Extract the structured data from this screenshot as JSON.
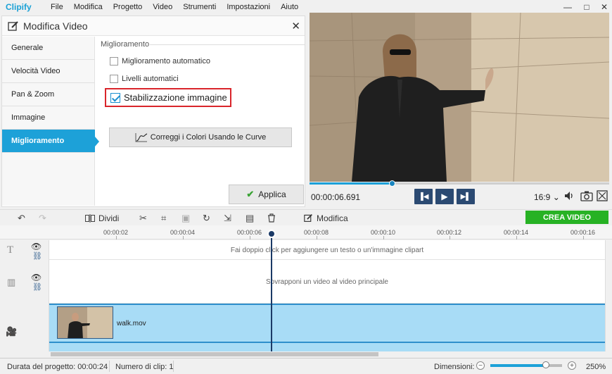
{
  "app": {
    "logo": "Clipify"
  },
  "menu": [
    "File",
    "Modifica",
    "Progetto",
    "Video",
    "Strumenti",
    "Impostazioni",
    "Aiuto"
  ],
  "window_controls": {
    "minimize": "—",
    "maximize": "□",
    "close": "✕"
  },
  "edit_panel": {
    "title": "Modifica Video",
    "nav": [
      {
        "label": "Generale",
        "active": false
      },
      {
        "label": "Velocità Video",
        "active": false
      },
      {
        "label": "Pan & Zoom",
        "active": false
      },
      {
        "label": "Immagine",
        "active": false
      },
      {
        "label": "Miglioramento",
        "active": true
      }
    ],
    "section_title": "Miglioramento",
    "options": {
      "auto_enhance": {
        "label": "Miglioramento automatico",
        "checked": false
      },
      "auto_levels": {
        "label": "Livelli automatici",
        "checked": false
      },
      "stabilization": {
        "label": "Stabilizzazione immagine",
        "checked": true
      }
    },
    "curves_button": "Correggi i Colori Usando le Curve",
    "apply_button": "Applica"
  },
  "player": {
    "time": "00:00:06.691",
    "progress": 0.275,
    "aspect_ratio": "16:9",
    "aspect_chevron": "⌄"
  },
  "toolbar": {
    "split_label": "Dividi",
    "edit_label": "Modifica",
    "create_label": "CREA VIDEO"
  },
  "ruler": [
    "00:00:02",
    "00:00:04",
    "00:00:06",
    "00:00:08",
    "00:00:10",
    "00:00:12",
    "00:00:14",
    "00:00:16"
  ],
  "tracks": {
    "text_hint": "Fai doppio click per aggiungere un testo o un'immagine clipart",
    "overlay_hint": "Sovrapponi un video al video principale",
    "clip_name": "walk.mov"
  },
  "status": {
    "duration_label": "Durata del progetto: 00:00:24",
    "clips_label": "Numero di clip: 1",
    "dimensions_label": "Dimensioni:",
    "zoom_minus": "−",
    "zoom_plus": "+",
    "zoom_value": "250%"
  },
  "colors": {
    "accent": "#1da1d8",
    "create": "#27b224",
    "highlight": "#d9252b",
    "transport": "#2b4a72"
  }
}
